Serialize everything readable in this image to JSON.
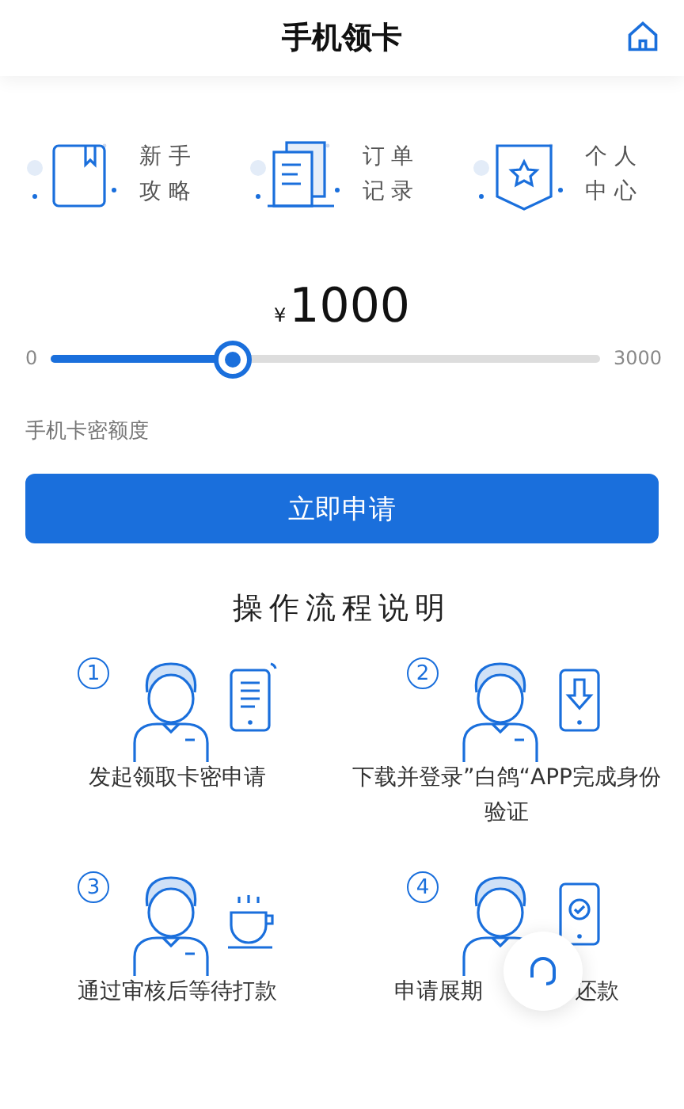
{
  "header": {
    "title": "手机领卡"
  },
  "shortcuts": [
    {
      "kind": "book",
      "line1": "新 手",
      "line2": "攻 略"
    },
    {
      "kind": "docs",
      "line1": "订 单",
      "line2": "记 录"
    },
    {
      "kind": "badge",
      "line1": "个 人",
      "line2": "中 心"
    }
  ],
  "amount": {
    "currency": "¥",
    "value": "1000"
  },
  "slider": {
    "min": "0",
    "max": "3000",
    "level": 0.333
  },
  "amount_label": "手机卡密额度",
  "apply_button": "立即申请",
  "process": {
    "title": "操作流程说明",
    "steps": [
      {
        "number": "1",
        "kind": "phone-doc",
        "texts": [
          "发起领取卡密申请"
        ]
      },
      {
        "number": "2",
        "kind": "phone-download",
        "texts": [
          "下载并登录”白鸽“APP完成身份验证"
        ]
      },
      {
        "number": "3",
        "kind": "cup",
        "texts": [
          "通过审核后等待打款"
        ]
      },
      {
        "number": "4",
        "kind": "phone-check",
        "texts": [
          "申请展期",
          "还款"
        ]
      }
    ]
  }
}
